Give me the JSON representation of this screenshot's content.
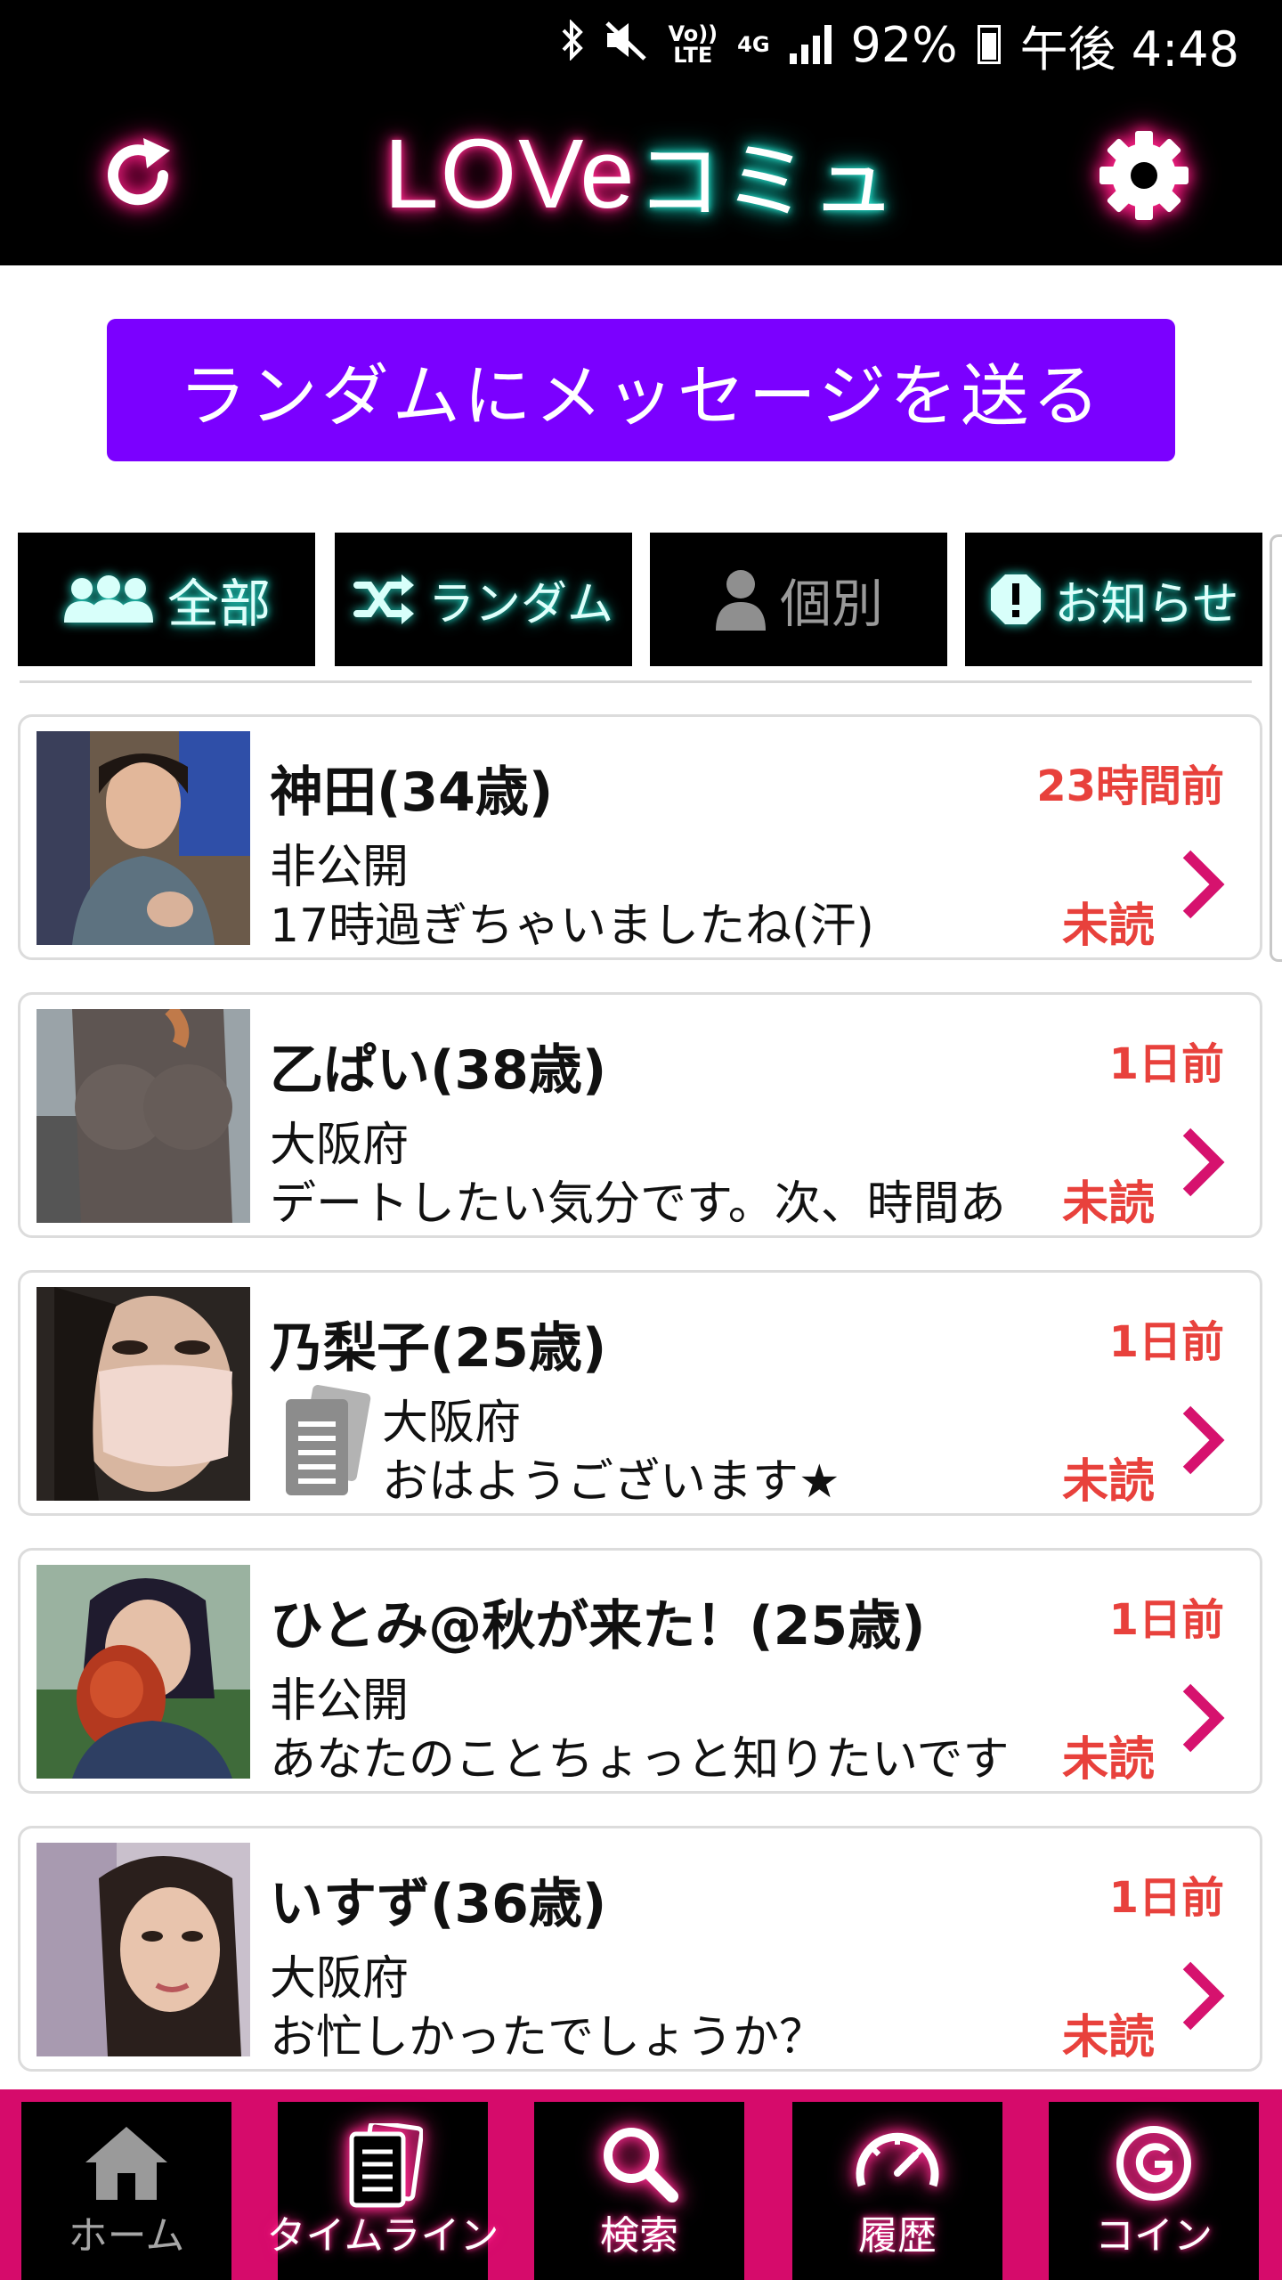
{
  "status_bar": {
    "icons": [
      "bluetooth-icon",
      "mute-icon",
      "volte-icon",
      "4g-icon",
      "signal-icon",
      "battery-icon"
    ],
    "volte_text": "Vo))\nLTE",
    "network": "4G",
    "battery": "92%",
    "time": "午後 4:48"
  },
  "header": {
    "logo_love": "LOVe",
    "logo_comm": "コミュ",
    "refresh_icon": "refresh-icon",
    "settings_icon": "gear-icon",
    "accent_pink": "#ff2a8c",
    "accent_cyan": "#27e9d6"
  },
  "random_button": {
    "label": "ランダムにメッセージを送る",
    "color": "#7b00ff"
  },
  "tabs": [
    {
      "label": "全部",
      "icon": "users-icon"
    },
    {
      "label": "ランダム",
      "icon": "shuffle-icon"
    },
    {
      "label": "個別",
      "icon": "user-icon"
    },
    {
      "label": "お知らせ",
      "icon": "alert-icon"
    }
  ],
  "messages": [
    {
      "name": "神田(34歳)",
      "time": "23時間前",
      "area": "非公開",
      "preview": "17時過ぎちゃいましたね(汗)",
      "status": "未読"
    },
    {
      "name": "乙ぱい(38歳)",
      "time": "1日前",
      "area": "大阪府",
      "preview": "デートしたい気分です。次、時間あ",
      "status": "未読"
    },
    {
      "name": "乃梨子(25歳)",
      "time": "1日前",
      "area": "大阪府",
      "preview": "おはようございます★",
      "status": "未読",
      "has_timeline_badge": true
    },
    {
      "name": "ひとみ@秋が来た！(25歳)",
      "time": "1日前",
      "area": "非公開",
      "preview": "あなたのことちょっと知りたいです",
      "status": "未読"
    },
    {
      "name": "いすず(36歳)",
      "time": "1日前",
      "area": "大阪府",
      "preview": "お忙しかったでしょうか？",
      "status": "未読"
    }
  ],
  "bottom_nav": [
    {
      "label": "ホーム",
      "icon": "home-icon"
    },
    {
      "label": "タイムライン",
      "icon": "timeline-icon"
    },
    {
      "label": "検索",
      "icon": "search-icon"
    },
    {
      "label": "履歴",
      "icon": "history-icon"
    },
    {
      "label": "コイン",
      "icon": "coin-icon"
    }
  ],
  "colors": {
    "nav_bg": "#d60b6b",
    "time_red": "#e8413c",
    "chevron": "#d6126e"
  }
}
